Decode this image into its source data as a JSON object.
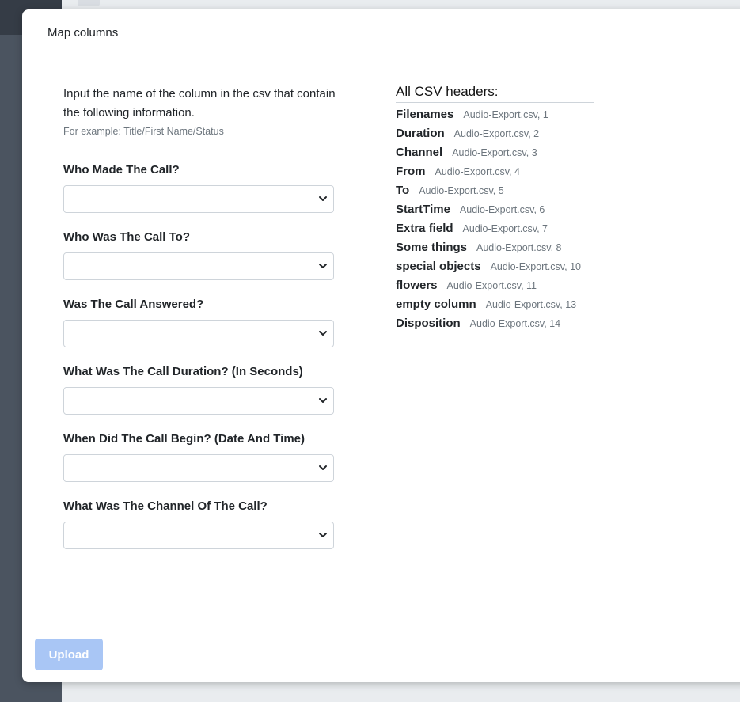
{
  "modal": {
    "title": "Map columns",
    "intro": "Input the name of the column in the csv that contain the following information.",
    "example": "For example: Title/First Name/Status",
    "fields": [
      {
        "label": "Who Made The Call?",
        "value": ""
      },
      {
        "label": "Who Was The Call To?",
        "value": ""
      },
      {
        "label": "Was The Call Answered?",
        "value": ""
      },
      {
        "label": "What Was The Call Duration? (In Seconds)",
        "value": ""
      },
      {
        "label": "When Did The Call Begin? (Date And Time)",
        "value": ""
      },
      {
        "label": "What Was The Channel Of The Call?",
        "value": ""
      }
    ],
    "csv_headers": {
      "title": "All CSV headers:",
      "items": [
        {
          "name": "Filenames",
          "source": "Audio-Export.csv, 1"
        },
        {
          "name": "Duration",
          "source": "Audio-Export.csv, 2"
        },
        {
          "name": "Channel",
          "source": "Audio-Export.csv, 3"
        },
        {
          "name": "From",
          "source": "Audio-Export.csv, 4"
        },
        {
          "name": "To",
          "source": "Audio-Export.csv, 5"
        },
        {
          "name": "StartTime",
          "source": "Audio-Export.csv, 6"
        },
        {
          "name": "Extra field",
          "source": "Audio-Export.csv, 7"
        },
        {
          "name": "Some things",
          "source": "Audio-Export.csv, 8"
        },
        {
          "name": "special objects",
          "source": "Audio-Export.csv, 10"
        },
        {
          "name": "flowers",
          "source": "Audio-Export.csv, 11"
        },
        {
          "name": "empty column",
          "source": "Audio-Export.csv, 13"
        },
        {
          "name": "Disposition",
          "source": "Audio-Export.csv, 14"
        }
      ]
    },
    "upload_label": "Upload"
  },
  "colors": {
    "upload_disabled": "#a9c6f5",
    "muted_text": "#6c757d",
    "backdrop": "#4b5460"
  },
  "icons": {
    "select_arrow": "chevron-down-icon"
  }
}
